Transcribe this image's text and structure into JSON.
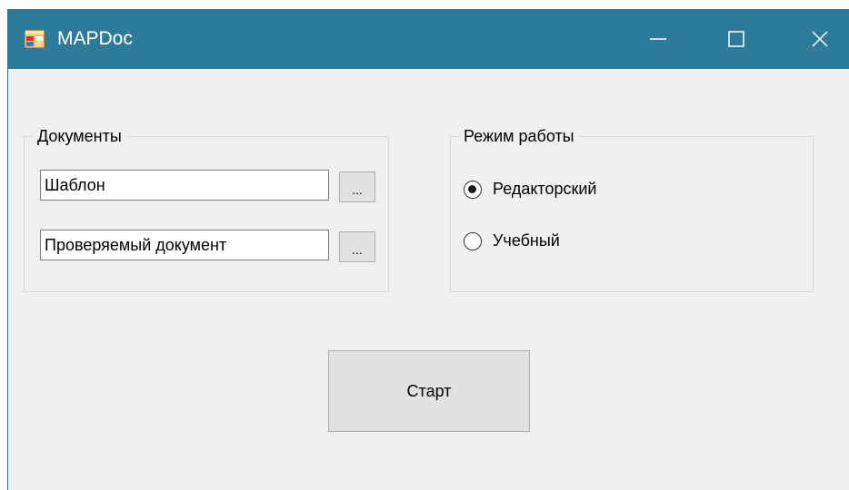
{
  "window": {
    "title": "MAPDoc",
    "titlebar_color": "#2e7b99",
    "controls": {
      "minimize": "minimize-icon",
      "maximize": "maximize-icon",
      "close": "close-icon"
    }
  },
  "documents_group": {
    "label": "Документы",
    "template_field": {
      "value": "Шаблон",
      "browse_label": "..."
    },
    "checked_document_field": {
      "value": "Проверяемый документ",
      "browse_label": "..."
    }
  },
  "mode_group": {
    "label": "Режим работы",
    "options": [
      {
        "label": "Редакторский",
        "checked": true
      },
      {
        "label": "Учебный",
        "checked": false
      }
    ]
  },
  "start_button": {
    "label": "Старт"
  }
}
